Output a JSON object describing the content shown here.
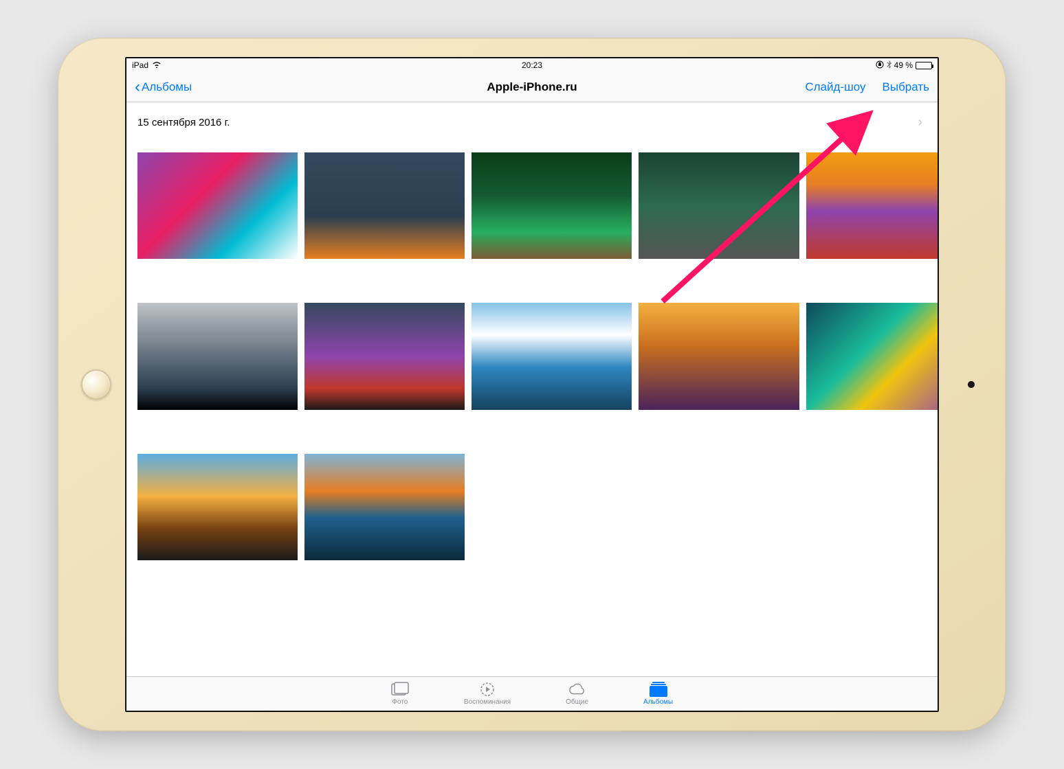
{
  "status": {
    "device": "iPad",
    "time": "20:23",
    "battery_pct": "49 %"
  },
  "nav": {
    "back_label": "Альбомы",
    "title": "Apple-iPhone.ru",
    "slideshow": "Слайд-шоу",
    "select": "Выбрать"
  },
  "section": {
    "date": "15 сентября 2016 г."
  },
  "thumbs": [
    {
      "favorite": false
    },
    {
      "favorite": false
    },
    {
      "favorite": false
    },
    {
      "favorite": false
    },
    {
      "favorite": false
    },
    {
      "favorite": false
    },
    {
      "favorite": true,
      "square": true
    },
    {
      "favorite": false
    },
    {
      "favorite": false
    },
    {
      "favorite": false
    },
    {
      "favorite": false
    },
    {
      "favorite": false
    },
    {
      "favorite": false
    },
    {
      "favorite": false
    },
    {
      "favorite": false
    },
    {
      "favorite": false
    }
  ],
  "tabs": {
    "photos": "Фото",
    "memories": "Воспоминания",
    "shared": "Общие",
    "albums": "Альбомы"
  },
  "colors": {
    "tint": "#007aff",
    "annotation": "#ff1464"
  }
}
